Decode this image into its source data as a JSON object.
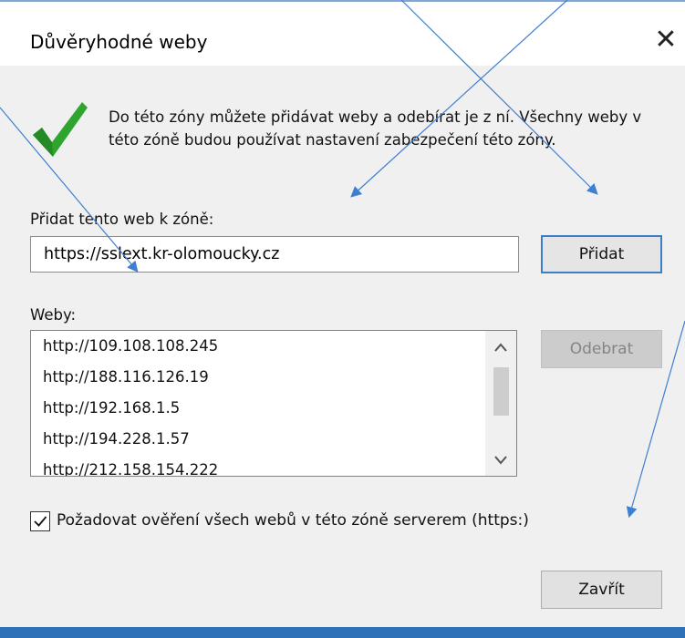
{
  "dialog": {
    "title": "Důvěryhodné weby",
    "close_glyph": "✕",
    "description": "Do této zóny můžete přidávat weby a odebírat je z ní. Všechny weby v této zóně budou používat nastavení zabezpečení této zóny.",
    "status_icon": "green-checkmark-icon"
  },
  "add_site": {
    "label": "Přidat tento web k zóně:",
    "value": "https://sslext.kr-olomoucky.cz",
    "button_label": "Přidat"
  },
  "websites": {
    "label": "Weby:",
    "items": [
      "http://109.108.108.245",
      "http://188.116.126.19",
      "http://192.168.1.5",
      "http://194.228.1.57",
      "http://212.158.154.222"
    ],
    "remove_button_label": "Odebrat"
  },
  "require_https": {
    "checked": true,
    "label": "Požadovat ověření všech webů v této zóně serverem (https:)"
  },
  "footer": {
    "close_button_label": "Zavřít"
  },
  "colors": {
    "window_bg": "#f0f0f0",
    "accent_blue": "#3c7fc8",
    "check_green": "#2fa52f",
    "annotation_arrow": "#3f7fd0"
  }
}
